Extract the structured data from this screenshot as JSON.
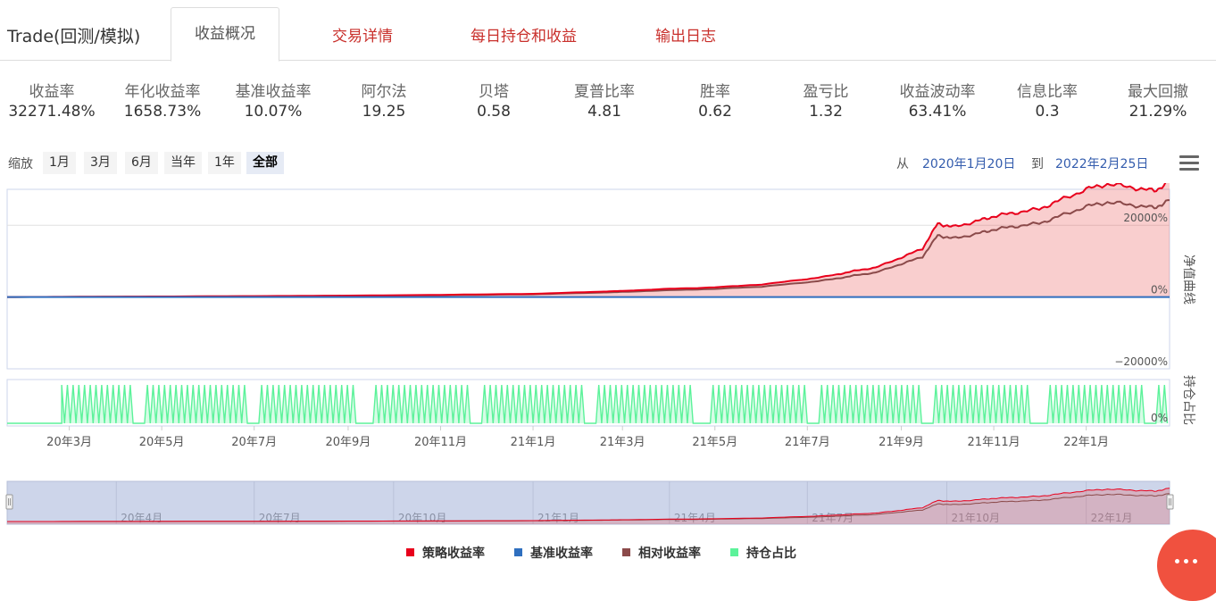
{
  "header": {
    "title": "Trade(回测/模拟)",
    "tabs": [
      {
        "label": "收益概况",
        "active": true
      },
      {
        "label": "交易详情",
        "active": false
      },
      {
        "label": "每日持仓和收益",
        "active": false
      },
      {
        "label": "输出日志",
        "active": false
      }
    ]
  },
  "stats": [
    {
      "label": "收益率",
      "value": "32271.48%"
    },
    {
      "label": "年化收益率",
      "value": "1658.73%"
    },
    {
      "label": "基准收益率",
      "value": "10.07%"
    },
    {
      "label": "阿尔法",
      "value": "19.25"
    },
    {
      "label": "贝塔",
      "value": "0.58"
    },
    {
      "label": "夏普比率",
      "value": "4.81"
    },
    {
      "label": "胜率",
      "value": "0.62"
    },
    {
      "label": "盈亏比",
      "value": "1.32"
    },
    {
      "label": "收益波动率",
      "value": "63.41%"
    },
    {
      "label": "信息比率",
      "value": "0.3"
    },
    {
      "label": "最大回撤",
      "value": "21.29%"
    }
  ],
  "toolbar": {
    "zoom_label": "缩放",
    "zoom_buttons": [
      "1月",
      "3月",
      "6月",
      "当年",
      "1年",
      "全部"
    ],
    "zoom_active": "全部",
    "from_label": "从",
    "from_date": "2020年1月20日",
    "to_label": "到",
    "to_date": "2022年2月25日",
    "menu_icon": "hamburger-menu-icon"
  },
  "chart_data": {
    "type": "line",
    "panes": [
      {
        "title": "净值曲线",
        "ytick_labels": [
          "20000%",
          "0%",
          "−20000%"
        ],
        "ylim": [
          -20000,
          30000
        ]
      },
      {
        "title": "持仓占比",
        "ytick_labels": [
          "0%"
        ],
        "ylim": [
          0,
          100
        ]
      }
    ],
    "x_tick_labels": [
      "20年3月",
      "20年5月",
      "20年7月",
      "20年9月",
      "20年11月",
      "21年1月",
      "21年3月",
      "21年5月",
      "21年7月",
      "21年9月",
      "21年11月",
      "22年1月"
    ],
    "navigator_labels": [
      "20年4月",
      "20年7月",
      "20年10月",
      "21年1月",
      "21年4月",
      "21年7月",
      "21年10月",
      "22年1月"
    ],
    "x_range": [
      "2020-01-20",
      "2022-02-25"
    ],
    "series": [
      {
        "name": "策略收益率",
        "color": "#e8001c",
        "x": [
          "2020-01-20",
          "2020-03-01",
          "2020-05-01",
          "2020-07-01",
          "2020-09-01",
          "2020-11-01",
          "2021-01-01",
          "2021-02-15",
          "2021-03-01",
          "2021-04-01",
          "2021-05-01",
          "2021-06-01",
          "2021-07-01",
          "2021-07-20",
          "2021-08-01",
          "2021-08-15",
          "2021-09-01",
          "2021-09-15",
          "2021-09-25",
          "2021-10-05",
          "2021-10-20",
          "2021-11-01",
          "2021-11-15",
          "2021-12-01",
          "2021-12-15",
          "2022-01-01",
          "2022-01-15",
          "2022-02-01",
          "2022-02-15",
          "2022-02-25"
        ],
        "values": [
          0,
          50,
          150,
          250,
          400,
          600,
          900,
          1500,
          1700,
          2300,
          2700,
          3500,
          5000,
          6200,
          7300,
          8200,
          11000,
          13500,
          20500,
          19500,
          21000,
          22500,
          23500,
          24500,
          27000,
          30000,
          31500,
          30500,
          29500,
          32271
        ]
      },
      {
        "name": "基准收益率",
        "color": "#2f6fbf",
        "x": [
          "2020-01-20",
          "2020-07-01",
          "2021-01-01",
          "2021-07-01",
          "2022-02-25"
        ],
        "values": [
          0,
          5,
          10,
          12,
          10.07
        ]
      },
      {
        "name": "相对收益率",
        "color": "#8b4a4a",
        "x": [
          "2020-01-20",
          "2020-03-01",
          "2020-05-01",
          "2020-07-01",
          "2020-09-01",
          "2020-11-01",
          "2021-01-01",
          "2021-02-15",
          "2021-03-01",
          "2021-04-01",
          "2021-05-01",
          "2021-06-01",
          "2021-07-01",
          "2021-07-20",
          "2021-08-01",
          "2021-08-15",
          "2021-09-01",
          "2021-09-15",
          "2021-09-25",
          "2021-10-05",
          "2021-10-20",
          "2021-11-01",
          "2021-11-15",
          "2021-12-01",
          "2021-12-15",
          "2022-01-01",
          "2022-01-15",
          "2022-02-01",
          "2022-02-15",
          "2022-02-25"
        ],
        "values": [
          0,
          40,
          120,
          210,
          330,
          500,
          750,
          1250,
          1420,
          1900,
          2250,
          2900,
          4100,
          5100,
          6000,
          6800,
          9200,
          11200,
          17200,
          16300,
          17500,
          18800,
          19700,
          20500,
          22600,
          25200,
          26400,
          25600,
          24800,
          27000
        ]
      },
      {
        "name": "持仓占比",
        "color": "#5cf29a",
        "x": [
          "2020-01-20",
          "2020-02-25",
          "2020-03-01",
          "2022-02-25"
        ],
        "values": [
          0,
          0,
          100,
          100
        ],
        "note_pattern": "oscillating"
      }
    ],
    "legend_position": "bottom",
    "grid": true
  }
}
